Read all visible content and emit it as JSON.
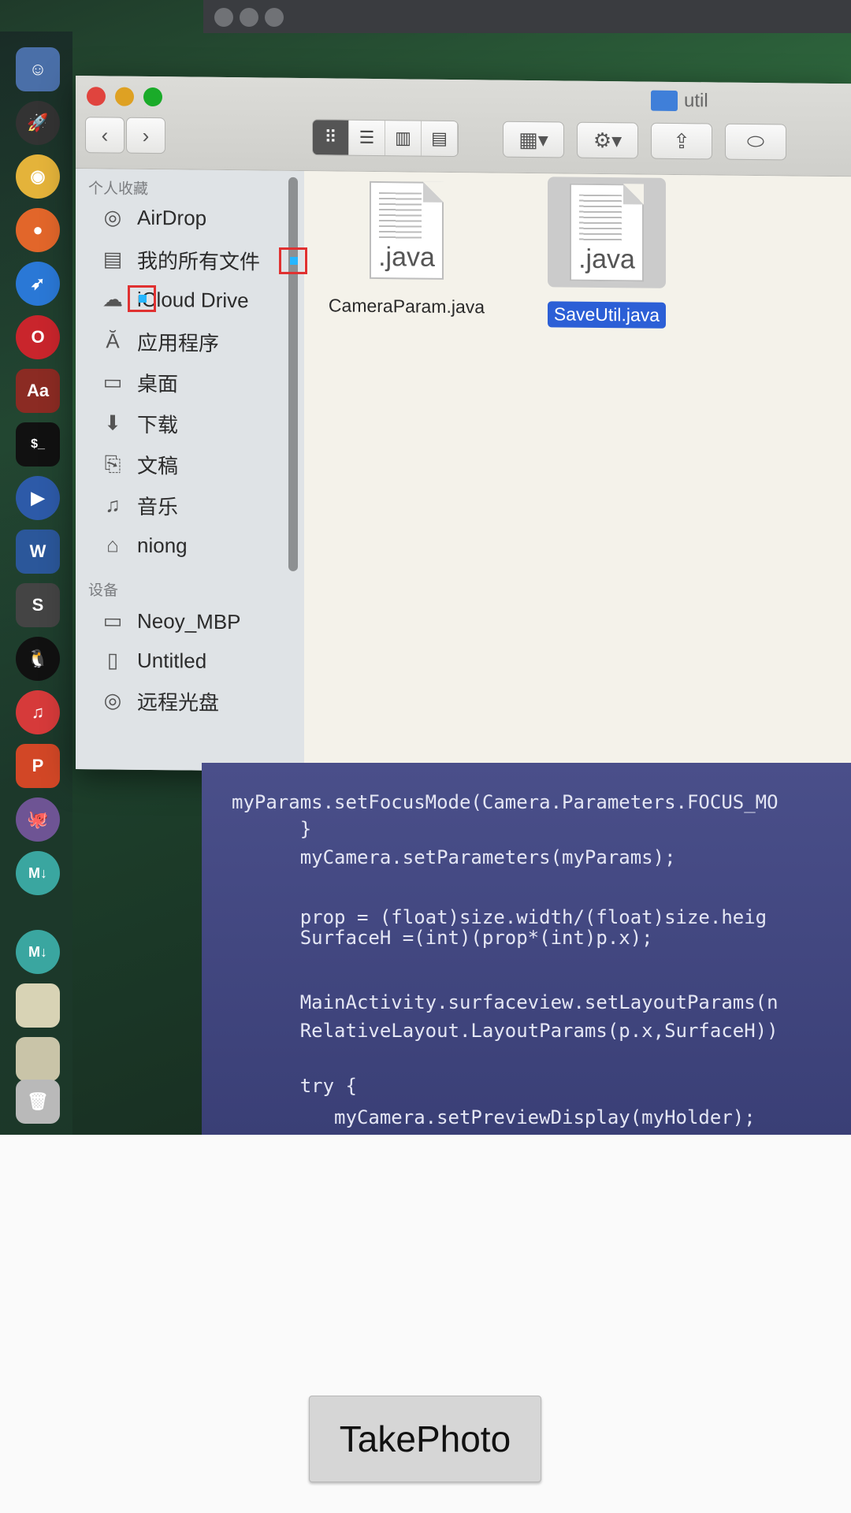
{
  "finder": {
    "window_title": "util",
    "sidebar": {
      "favorites_header": "个人收藏",
      "favorites": [
        {
          "label": "AirDrop",
          "icon": "airdrop-icon"
        },
        {
          "label": "我的所有文件",
          "icon": "all-files-icon"
        },
        {
          "label": "iCloud Drive",
          "icon": "cloud-icon"
        },
        {
          "label": "应用程序",
          "icon": "applications-icon"
        },
        {
          "label": "桌面",
          "icon": "desktop-icon"
        },
        {
          "label": "下载",
          "icon": "download-icon"
        },
        {
          "label": "文稿",
          "icon": "documents-icon"
        },
        {
          "label": "音乐",
          "icon": "music-icon"
        },
        {
          "label": "niong",
          "icon": "home-icon"
        }
      ],
      "devices_header": "设备",
      "devices": [
        {
          "label": "Neoy_MBP",
          "icon": "laptop-icon"
        },
        {
          "label": "Untitled",
          "icon": "disk-icon"
        },
        {
          "label": "远程光盘",
          "icon": "optical-disc-icon"
        }
      ]
    },
    "files": [
      {
        "name": "CameraParam.java",
        "ext": ".java",
        "selected": false
      },
      {
        "name": "SaveUtil.java",
        "ext": ".java",
        "selected": true
      }
    ]
  },
  "code": {
    "lines": [
      "myParams.setFocusMode(Camera.Parameters.FOCUS_MO",
      "      }",
      "      myCamera.setParameters(myParams);",
      "",
      "      prop = (float)size.width/(float)size.heig",
      "      SurfaceH =(int)(prop*(int)p.x);",
      "",
      "      MainActivity.surfaceview.setLayoutParams(n",
      "      RelativeLayout.LayoutParams(p.x,SurfaceH))",
      "",
      "      try {",
      "         myCamera.setPreviewDisplay(myHolder);"
    ]
  },
  "app": {
    "take_photo_label": "TakePhoto"
  }
}
